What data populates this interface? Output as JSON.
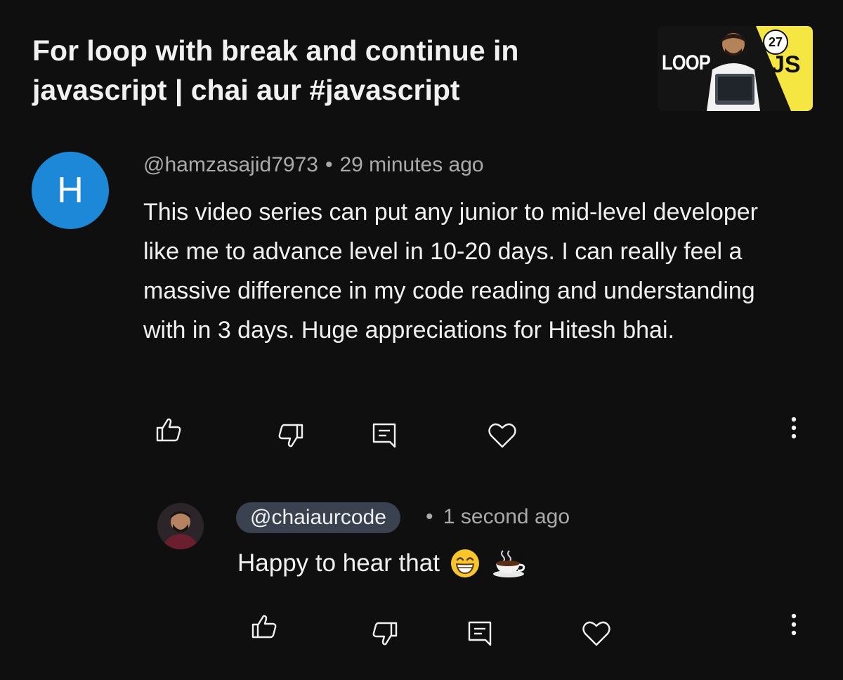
{
  "video": {
    "title": "For loop with break and continue in javascript | chai aur #javascript",
    "thumbnail": {
      "loop_text": "LOOP",
      "js_text": "JS",
      "episode_badge": "27",
      "accent_color": "#f5e642"
    }
  },
  "comment": {
    "avatar_letter": "H",
    "avatar_color": "#1e88d8",
    "author": "@hamzasajid7973",
    "separator": "•",
    "time": "29 minutes ago",
    "text": "This video series can put any junior to mid-level developer like me to advance level in 10-20 days. I can really feel a massive difference in my code reading and understanding with in 3 days. Huge appreciations for Hitesh bhai.",
    "actions": [
      "like-icon",
      "dislike-icon",
      "reply-icon",
      "heart-icon",
      "more-vert-icon"
    ]
  },
  "reply": {
    "author": "@chaiaurcode",
    "separator": "•",
    "time": "1 second ago",
    "text": "Happy to hear that",
    "emojis": [
      "grinning-face-emoji",
      "hot-beverage-emoji"
    ],
    "actions": [
      "like-icon",
      "dislike-icon",
      "reply-icon",
      "heart-icon",
      "more-vert-icon"
    ]
  }
}
